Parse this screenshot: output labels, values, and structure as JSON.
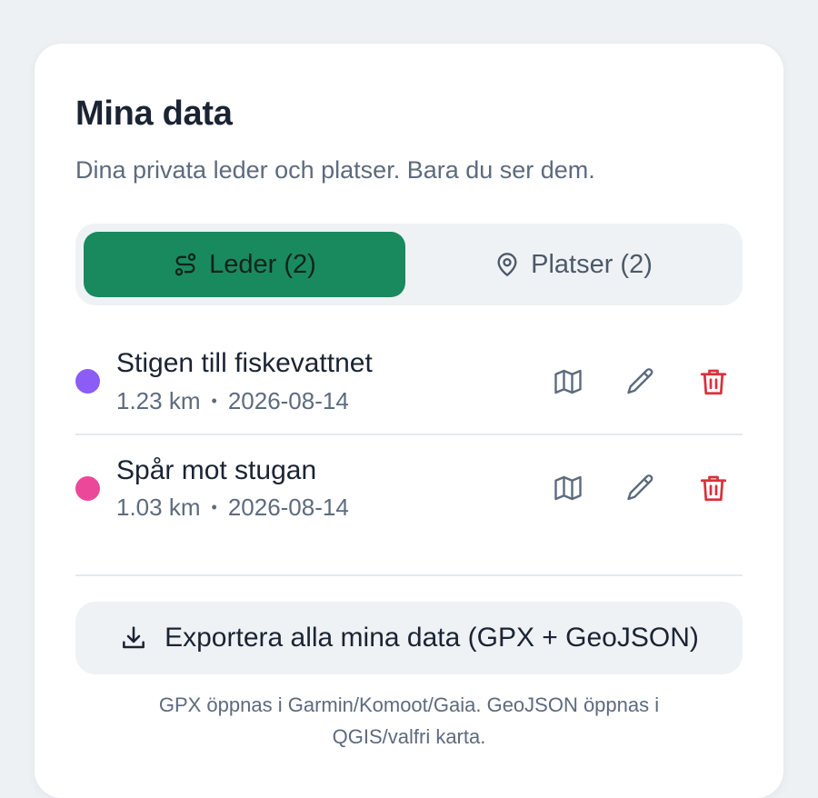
{
  "header": {
    "title": "Mina data",
    "subtitle": "Dina privata leder och platser. Bara du ser dem."
  },
  "tabs": [
    {
      "label": "Leder (2)",
      "icon": "route-icon",
      "active": true
    },
    {
      "label": "Platser (2)",
      "icon": "map-pin-icon",
      "active": false
    }
  ],
  "routes": [
    {
      "name": "Stigen till fiskevattnet",
      "distance": "1.23 km",
      "separator": "•",
      "date": "2026-08-14",
      "color": "#8b5cf6"
    },
    {
      "name": "Spår mot stugan",
      "distance": "1.03 km",
      "separator": "•",
      "date": "2026-08-14",
      "color": "#ec4899"
    }
  ],
  "actions": {
    "map_icon": "map-icon",
    "edit_icon": "pencil-icon",
    "delete_icon": "trash-icon"
  },
  "export": {
    "label": "Exportera alla mina data (GPX + GeoJSON)",
    "icon": "download-icon",
    "note_line1": "GPX öppnas i Garmin/Komoot/Gaia. GeoJSON öppnas i",
    "note_line2": "QGIS/valfri karta."
  },
  "colors": {
    "accent": "#198a5e",
    "danger": "#dc2f3c",
    "text": "#1b2433",
    "muted": "#5d6b7e"
  }
}
